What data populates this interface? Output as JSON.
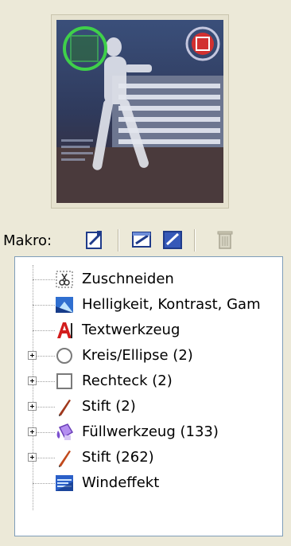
{
  "toolbar": {
    "makro_label": "Makro:"
  },
  "tree": {
    "items": [
      {
        "label": "Zuschneiden",
        "icon": "crop-icon",
        "expandable": false
      },
      {
        "label": "Helligkeit, Kontrast, Gam",
        "icon": "brightness-contrast-icon",
        "expandable": false
      },
      {
        "label": "Textwerkzeug",
        "icon": "text-tool-icon",
        "expandable": false
      },
      {
        "label": "Kreis/Ellipse (2)",
        "icon": "ellipse-icon",
        "expandable": true
      },
      {
        "label": "Rechteck (2)",
        "icon": "rectangle-icon",
        "expandable": true
      },
      {
        "label": "Stift (2)",
        "icon": "pen-icon",
        "expandable": true
      },
      {
        "label": "Füllwerkzeug (133)",
        "icon": "fill-tool-icon",
        "expandable": true
      },
      {
        "label": "Stift (262)",
        "icon": "pen-icon",
        "expandable": true
      },
      {
        "label": "Windeffekt",
        "icon": "wind-effect-icon",
        "expandable": false
      }
    ]
  },
  "colors": {
    "panel_bg": "#ece9d8",
    "tree_border": "#7f9db9"
  }
}
